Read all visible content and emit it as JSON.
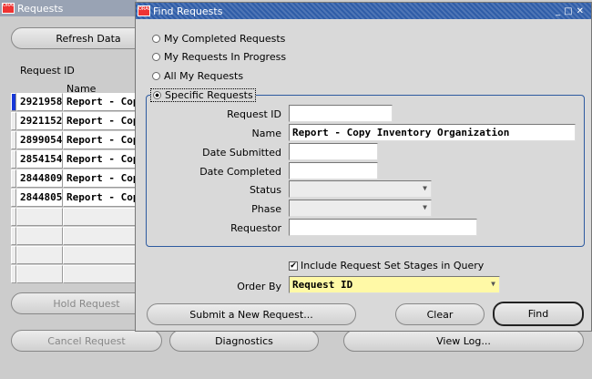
{
  "main_window": {
    "title": "Requests",
    "refresh_button": "Refresh Data",
    "col_request_id": "Request ID",
    "col_name": "Name",
    "rows": [
      {
        "id": "2921958",
        "name": "Report - Copy"
      },
      {
        "id": "2921152",
        "name": "Report - Copy"
      },
      {
        "id": "2899054",
        "name": "Report - Copy"
      },
      {
        "id": "2854154",
        "name": "Report - Copy"
      },
      {
        "id": "2844809",
        "name": "Report - Copy"
      },
      {
        "id": "2844805",
        "name": "Report - Copy"
      }
    ],
    "hold_button": "Hold Request",
    "cancel_button": "Cancel Request",
    "diagnostics_button": "Diagnostics",
    "view_log_button": "View Log..."
  },
  "find_window": {
    "title": "Find Requests",
    "radios": [
      {
        "label": "My Completed Requests",
        "selected": false
      },
      {
        "label": "My Requests In Progress",
        "selected": false
      },
      {
        "label": "All My Requests",
        "selected": false
      },
      {
        "label": "Specific Requests",
        "selected": true
      }
    ],
    "fields": {
      "request_id": {
        "label": "Request ID",
        "value": ""
      },
      "name": {
        "label": "Name",
        "value": "Report - Copy Inventory Organization"
      },
      "date_submitted": {
        "label": "Date Submitted",
        "value": ""
      },
      "date_completed": {
        "label": "Date Completed",
        "value": ""
      },
      "status": {
        "label": "Status",
        "value": ""
      },
      "phase": {
        "label": "Phase",
        "value": ""
      },
      "requestor": {
        "label": "Requestor",
        "value": ""
      }
    },
    "include_stages": {
      "label": "Include Request Set Stages in Query",
      "checked": true
    },
    "order_by": {
      "label": "Order By",
      "value": "Request ID"
    },
    "submit_button": "Submit a New Request...",
    "clear_button": "Clear",
    "find_button": "Find"
  },
  "colors": {
    "find_title_bar": "#2f5da8",
    "bg_title_bar": "#99a3b4",
    "order_by_field": "#fff9a6"
  }
}
